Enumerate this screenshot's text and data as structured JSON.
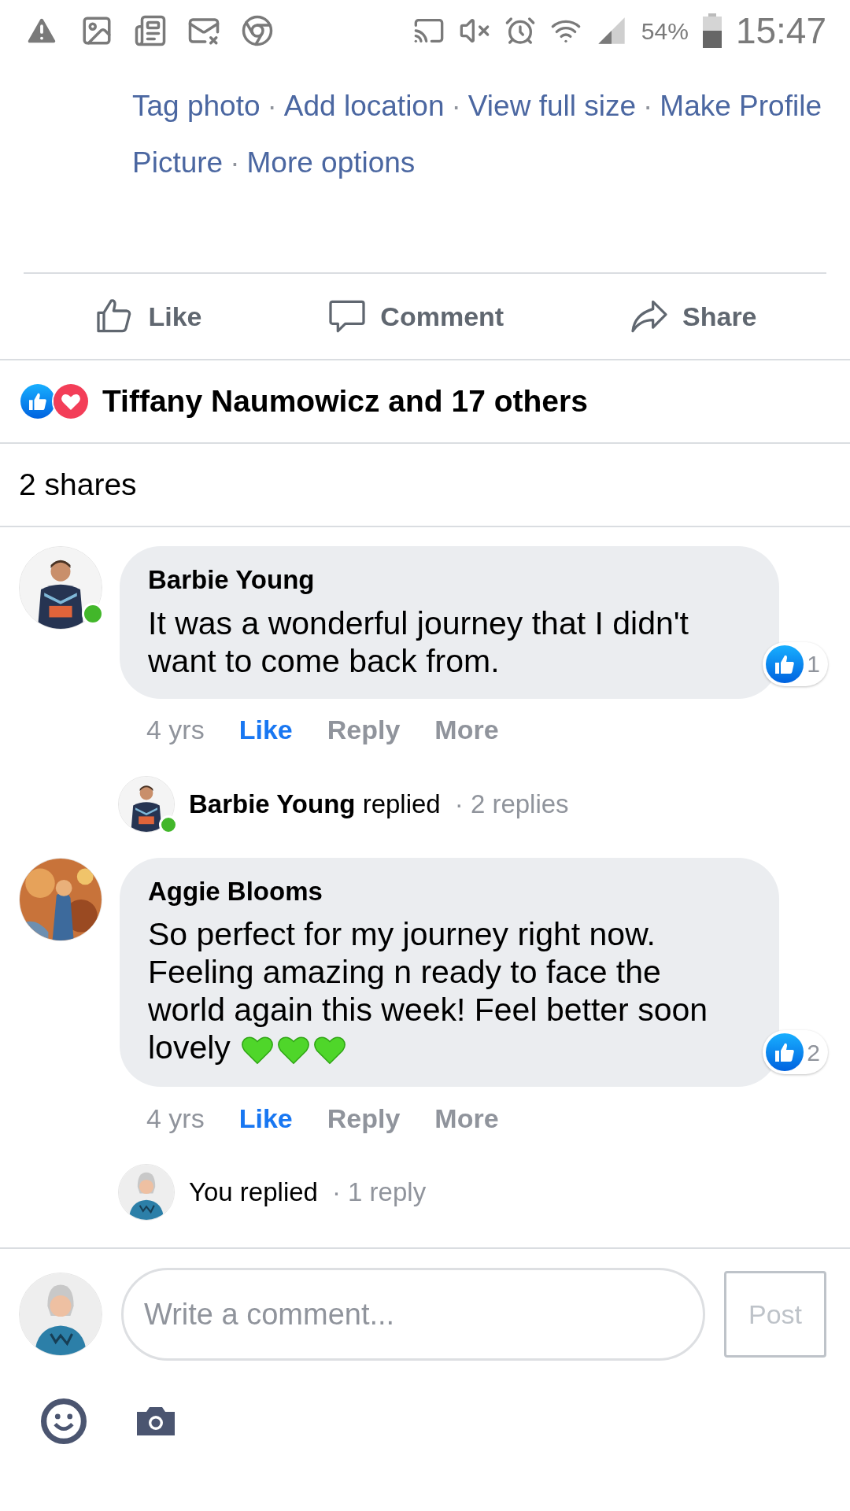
{
  "status_bar": {
    "battery": "54%",
    "time": "15:47"
  },
  "photo_links": [
    [
      {
        "kind": "link",
        "text": "Tag photo"
      },
      {
        "kind": "separator",
        "text": "·"
      },
      {
        "kind": "link",
        "text": "Add location"
      },
      {
        "kind": "separator",
        "text": "·"
      },
      {
        "kind": "link",
        "text": "View full size"
      },
      {
        "kind": "separator",
        "text": "·"
      },
      {
        "kind": "link",
        "text": "Make Profile"
      }
    ],
    [
      {
        "kind": "link",
        "text": "Picture"
      },
      {
        "kind": "separator",
        "text": "·"
      },
      {
        "kind": "link",
        "text": "More options"
      }
    ]
  ],
  "post_actions": [
    {
      "kind": "like",
      "label": "Like"
    },
    {
      "kind": "comment",
      "label": "Comment"
    },
    {
      "kind": "share",
      "label": "Share"
    }
  ],
  "reactions": {
    "text": "Tiffany Naumowicz and 17 others"
  },
  "shares": "2 shares",
  "comments": [
    {
      "author": "Barbie Young",
      "online": true,
      "text": "It was a wonderful journey that I didn't want to come back from.",
      "likes": "1",
      "time": "4 yrs",
      "liked": true,
      "actions": [
        "Like",
        "Reply",
        "More"
      ],
      "replies": {
        "online": true,
        "text": "**Barbie Young** replied",
        "count": "· 2 replies"
      }
    },
    {
      "author": "Aggie Blooms",
      "text": "So perfect for my journey right now. Feeling amazing n ready to face the world again this week! Feel better soon lovely",
      "emojis": [
        {
          "kind": "green-heart"
        },
        {
          "kind": "green-heart"
        },
        {
          "kind": "green-heart"
        }
      ],
      "likes": "2",
      "time": "4 yrs",
      "liked": true,
      "actions": [
        "Like",
        "Reply",
        "More"
      ],
      "replies": {
        "text": "You replied",
        "count": "· 1 reply"
      }
    }
  ],
  "composer": {
    "placeholder": "Write a comment...",
    "post": "Post",
    "post_disabled": true
  }
}
